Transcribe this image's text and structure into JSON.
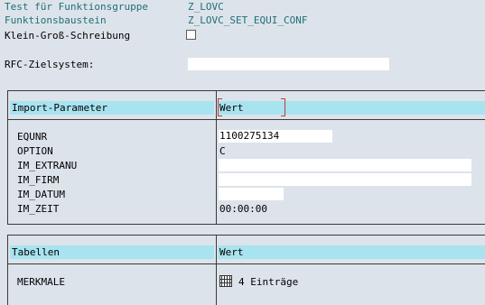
{
  "header": {
    "rows": [
      {
        "label": "Test für Funktionsgruppe",
        "value": "Z_LOVC"
      },
      {
        "label": "Funktionsbaustein",
        "value": "Z_LOVC_SET_EQUI_CONF"
      }
    ],
    "case_label": "Klein-Groß-Schreibung",
    "case_checked": false,
    "rfc_label": "RFC-Zielsystem:",
    "rfc_value": ""
  },
  "import": {
    "col_name": "Import-Parameter",
    "col_value": "Wert",
    "params": [
      {
        "name": "EQUNR",
        "value": "1100275134"
      },
      {
        "name": "OPTION",
        "value": "C"
      },
      {
        "name": "IM_EXTRANU",
        "value": ""
      },
      {
        "name": "IM_FIRM",
        "value": ""
      },
      {
        "name": "IM_DATUM",
        "value": ""
      },
      {
        "name": "IM_ZEIT",
        "value": "00:00:00"
      }
    ]
  },
  "tables": {
    "col_name": "Tabellen",
    "col_value": "Wert",
    "rows": [
      {
        "name": "MERKMALE",
        "icon": "table-icon",
        "value": "4 Einträge"
      }
    ]
  }
}
